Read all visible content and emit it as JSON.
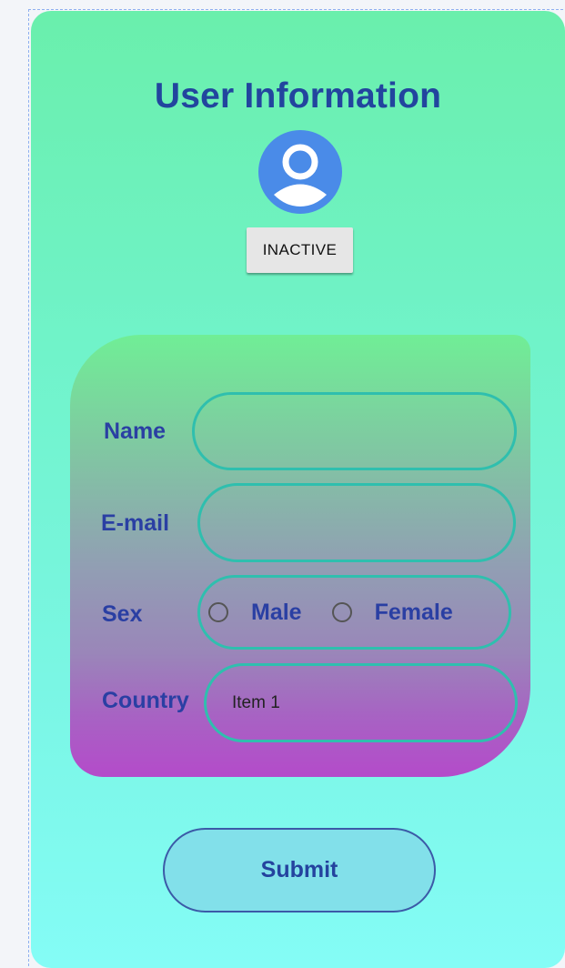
{
  "header": {
    "title": "User Information",
    "avatar_icon": "account-circle-icon",
    "status_button_label": "INACTIVE"
  },
  "form": {
    "name": {
      "label": "Name",
      "value": ""
    },
    "email": {
      "label": "E-mail",
      "value": ""
    },
    "sex": {
      "label": "Sex",
      "options": [
        {
          "label": "Male",
          "selected": false
        },
        {
          "label": "Female",
          "selected": false
        }
      ]
    },
    "country": {
      "label": "Country",
      "value": "Item 1"
    }
  },
  "submit_label": "Submit",
  "colors": {
    "title": "#22459e",
    "label": "#2a3fa3",
    "field_border": "#2fbfae",
    "avatar": "#4a8be8",
    "card_top": "#70ee96",
    "card_bottom": "#b44bca",
    "page_top": "#6aefac",
    "page_bottom": "#84fcf6"
  }
}
